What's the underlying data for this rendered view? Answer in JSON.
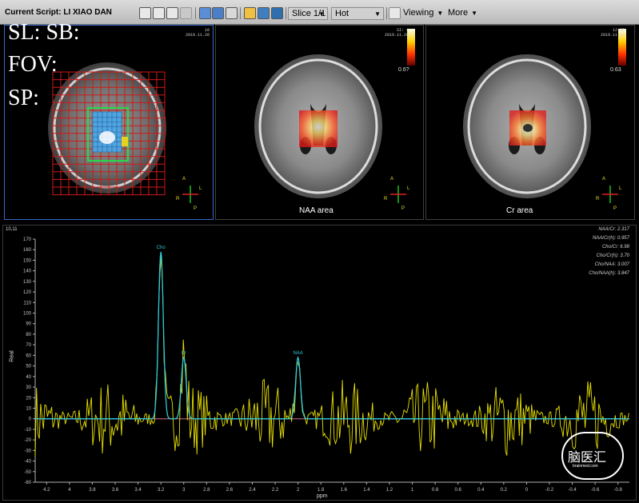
{
  "toolbar": {
    "title_prefix": "Current Script: ",
    "title_patient": "LI XIAO DAN",
    "slice_label": "Slice 1/1",
    "colormap_label": "Hot",
    "viewing_label": "Viewing",
    "more_label": "More"
  },
  "overlay": {
    "line1": "SL: SB:",
    "line2": "FOV:",
    "line3": "SP:"
  },
  "view1": {
    "tl": "LI XIAO DAN",
    "tr1": "10",
    "tr2": "2019.11.26"
  },
  "view2": {
    "caption": "NAA area",
    "tr1": "SI: 4",
    "tr2": "2019.11.26",
    "scale_top": "",
    "scale_mid": "0.6?"
  },
  "view3": {
    "caption": "Cr area",
    "tr1": "12.68",
    "tr2": "2019.11.26",
    "scale_mid": "0.63"
  },
  "orientation": {
    "a": "A",
    "p": "P",
    "r": "R",
    "l": "L"
  },
  "spectrum": {
    "corner_label": "10,11",
    "y_axis_label": "Real",
    "x_axis_label": "ppm",
    "ratios": [
      "NAA/Cr: 2.317",
      "NAA/Cr(h): 0.957",
      "Cho/Cr: 6.98",
      "Cho/Cr(h): 3.70",
      "Cho/NAA: 3.007",
      "Cho/NAA(h): 3.847"
    ],
    "watermark_cn": "脑医汇",
    "watermark_en": "brainmed.com"
  },
  "chart_data": {
    "type": "line",
    "title": "",
    "xlabel": "ppm",
    "ylabel": "Real",
    "xlim": [
      4.3,
      -0.9
    ],
    "ylim": [
      -60,
      170
    ],
    "x_reversed": true,
    "xticks": [
      4.2,
      4,
      3.8,
      3.6,
      3.4,
      3.2,
      3,
      2.8,
      2.6,
      2.4,
      2.2,
      2,
      1.8,
      1.6,
      1.4,
      1.2,
      1,
      0.8,
      0.6,
      0.4,
      0.2,
      0,
      -0.2,
      -0.4,
      -0.6,
      -0.8
    ],
    "yticks": [
      170,
      160,
      150,
      140,
      130,
      120,
      110,
      100,
      90,
      80,
      70,
      60,
      50,
      40,
      30,
      20,
      10,
      0,
      -10,
      -20,
      -30,
      -40,
      -50,
      -60
    ],
    "peaks": [
      {
        "label": "Cho",
        "ppm": 3.2,
        "height": 158
      },
      {
        "label": "Cr",
        "ppm": 3.0,
        "height": 58
      },
      {
        "label": "NAA",
        "ppm": 2.0,
        "height": 58
      }
    ],
    "series": [
      {
        "name": "",
        "color": "#e8e000"
      },
      {
        "name": "",
        "color": "#2ec8d8"
      },
      {
        "name": "",
        "color": "#d07090"
      }
    ]
  }
}
